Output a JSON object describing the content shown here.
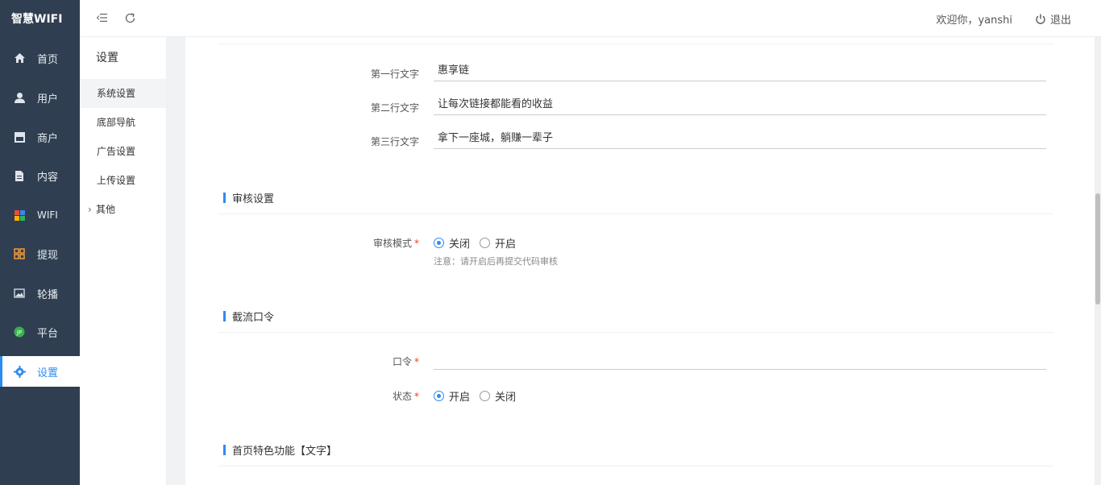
{
  "app": {
    "brand": "智慧WIFI"
  },
  "sidebar": {
    "items": [
      {
        "label": "首页",
        "icon": "home-icon"
      },
      {
        "label": "用户",
        "icon": "user-icon"
      },
      {
        "label": "商户",
        "icon": "store-icon"
      },
      {
        "label": "内容",
        "icon": "document-icon"
      },
      {
        "label": "WIFI",
        "icon": "wifi-tiles-icon"
      },
      {
        "label": "提现",
        "icon": "grid-icon"
      },
      {
        "label": "轮播",
        "icon": "image-icon"
      },
      {
        "label": "平台",
        "icon": "platform-icon"
      },
      {
        "label": "设置",
        "icon": "gear-icon"
      }
    ],
    "active_index": 8
  },
  "topbar": {
    "welcome": "欢迎你，yanshi",
    "logout": "退出"
  },
  "submenu": {
    "title": "设置",
    "items": [
      {
        "label": "系统设置"
      },
      {
        "label": "底部导航"
      },
      {
        "label": "广告设置"
      },
      {
        "label": "上传设置"
      },
      {
        "label": "其他"
      }
    ]
  },
  "form": {
    "line1": {
      "label": "第一行文字",
      "value": "惠享链"
    },
    "line2": {
      "label": "第二行文字",
      "value": "让每次链接都能看的收益"
    },
    "line3": {
      "label": "第三行文字",
      "value": "拿下一座城，躺赚一辈子"
    },
    "audit": {
      "title": "审核设置",
      "mode_label": "审核模式",
      "options": [
        "关闭",
        "开启"
      ],
      "selected": "关闭",
      "hint": "注意：请开启后再提交代码审核"
    },
    "intercept": {
      "title": "截流口令",
      "password_label": "口令",
      "password_value": "",
      "status_label": "状态",
      "options": [
        "开启",
        "关闭"
      ],
      "selected": "开启"
    },
    "feature": {
      "title": "首页特色功能【文字】"
    }
  },
  "colors": {
    "sidebar_bg": "#2f3e50",
    "accent": "#2d8cf0",
    "required": "#ed4014"
  }
}
